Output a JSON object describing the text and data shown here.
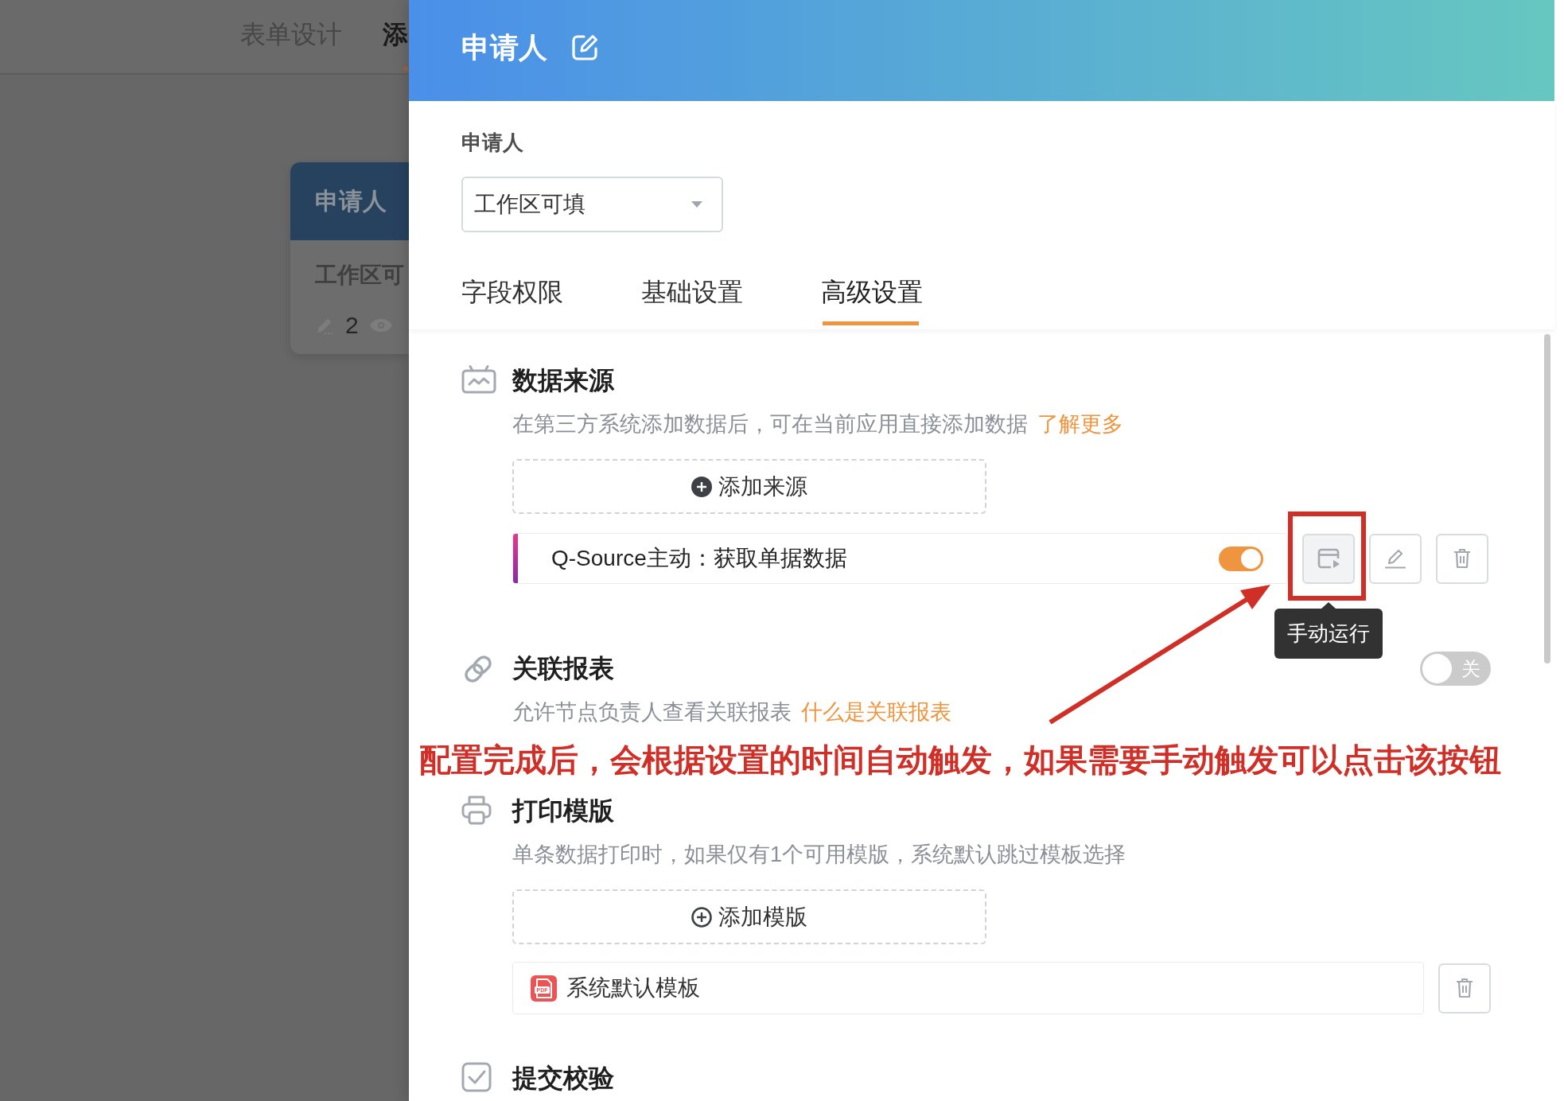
{
  "backdrop": {
    "tabs": [
      {
        "label": "表单设计",
        "selected": false
      },
      {
        "label": "添",
        "selected": true
      }
    ],
    "card": {
      "title": "申请人",
      "subtitle": "工作区可",
      "edit_count": "2"
    }
  },
  "drawer": {
    "title": "申请人",
    "field_label": "申请人",
    "permission_select": {
      "value": "工作区可填"
    },
    "tabs": [
      {
        "label": "字段权限",
        "selected": false
      },
      {
        "label": "基础设置",
        "selected": false
      },
      {
        "label": "高级设置",
        "selected": true
      }
    ],
    "sections": [
      {
        "kind": "data_source",
        "title": "数据来源",
        "description": "在第三方系统添加数据后，可在当前应用直接添加数据",
        "link": "了解更多",
        "add_button": "添加来源",
        "items": [
          {
            "name": "Q-Source主动：获取单据数据",
            "on": true,
            "tooltip": "手动运行"
          }
        ]
      },
      {
        "kind": "linked_report",
        "title": "关联报表",
        "description": "允许节点负责人查看关联报表",
        "link": "什么是关联报表",
        "toggle": {
          "on": false,
          "label": "关"
        }
      },
      {
        "kind": "print_template",
        "title": "打印模版",
        "description": "单条数据打印时，如果仅有1个可用模版，系统默认跳过模板选择",
        "add_button": "添加模版",
        "items": [
          {
            "name": "系统默认模板",
            "file_type": "PDF"
          }
        ]
      },
      {
        "kind": "submit_check",
        "title": "提交校验"
      }
    ]
  },
  "annotation": {
    "text": "配置完成后，会根据设置的时间自动触发，如果需要手动触发可以点击该按钮"
  }
}
